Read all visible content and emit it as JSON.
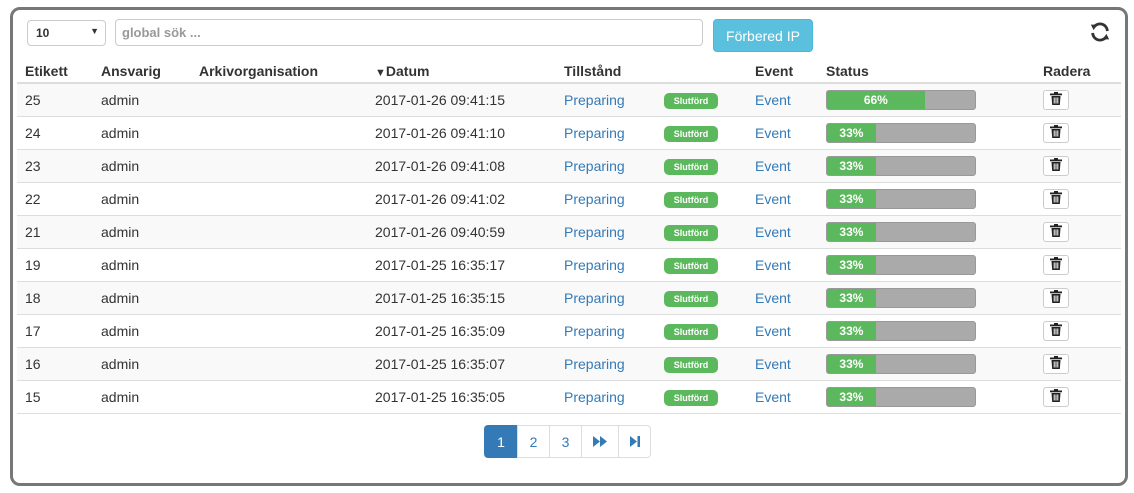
{
  "toolbar": {
    "page_size": "10",
    "search_placeholder": "global sök ...",
    "prepare_label": "Förbered IP"
  },
  "columns": {
    "label": "Etikett",
    "responsible": "Ansvarig",
    "archive_org": "Arkivorganisation",
    "sort_arrow": "▼",
    "date": "Datum",
    "state": "Tillstånd",
    "event": "Event",
    "status": "Status",
    "delete": "Radera"
  },
  "rows": [
    {
      "label": "25",
      "responsible": "admin",
      "archive_org": "",
      "date": "2017-01-26 09:41:15",
      "state": "Preparing",
      "badge": "Slutförd",
      "event": "Event",
      "progress": 66,
      "progress_label": "66%"
    },
    {
      "label": "24",
      "responsible": "admin",
      "archive_org": "",
      "date": "2017-01-26 09:41:10",
      "state": "Preparing",
      "badge": "Slutförd",
      "event": "Event",
      "progress": 33,
      "progress_label": "33%"
    },
    {
      "label": "23",
      "responsible": "admin",
      "archive_org": "",
      "date": "2017-01-26 09:41:08",
      "state": "Preparing",
      "badge": "Slutförd",
      "event": "Event",
      "progress": 33,
      "progress_label": "33%"
    },
    {
      "label": "22",
      "responsible": "admin",
      "archive_org": "",
      "date": "2017-01-26 09:41:02",
      "state": "Preparing",
      "badge": "Slutförd",
      "event": "Event",
      "progress": 33,
      "progress_label": "33%"
    },
    {
      "label": "21",
      "responsible": "admin",
      "archive_org": "",
      "date": "2017-01-26 09:40:59",
      "state": "Preparing",
      "badge": "Slutförd",
      "event": "Event",
      "progress": 33,
      "progress_label": "33%"
    },
    {
      "label": "19",
      "responsible": "admin",
      "archive_org": "",
      "date": "2017-01-25 16:35:17",
      "state": "Preparing",
      "badge": "Slutförd",
      "event": "Event",
      "progress": 33,
      "progress_label": "33%"
    },
    {
      "label": "18",
      "responsible": "admin",
      "archive_org": "",
      "date": "2017-01-25 16:35:15",
      "state": "Preparing",
      "badge": "Slutförd",
      "event": "Event",
      "progress": 33,
      "progress_label": "33%"
    },
    {
      "label": "17",
      "responsible": "admin",
      "archive_org": "",
      "date": "2017-01-25 16:35:09",
      "state": "Preparing",
      "badge": "Slutförd",
      "event": "Event",
      "progress": 33,
      "progress_label": "33%"
    },
    {
      "label": "16",
      "responsible": "admin",
      "archive_org": "",
      "date": "2017-01-25 16:35:07",
      "state": "Preparing",
      "badge": "Slutförd",
      "event": "Event",
      "progress": 33,
      "progress_label": "33%"
    },
    {
      "label": "15",
      "responsible": "admin",
      "archive_org": "",
      "date": "2017-01-25 16:35:05",
      "state": "Preparing",
      "badge": "Slutförd",
      "event": "Event",
      "progress": 33,
      "progress_label": "33%"
    }
  ],
  "pagination": {
    "pages": [
      "1",
      "2",
      "3"
    ],
    "active": "1",
    "next_icon": "fast-forward-icon",
    "last_icon": "skip-to-end-icon"
  },
  "icons": {
    "refresh": "refresh-icon",
    "delete": "trash-icon",
    "dropdown": "caret-down-icon"
  },
  "colors": {
    "primary": "#337ab7",
    "info_button": "#5bc0de",
    "success": "#5cb85c",
    "progress_track": "#aaaaaa"
  }
}
